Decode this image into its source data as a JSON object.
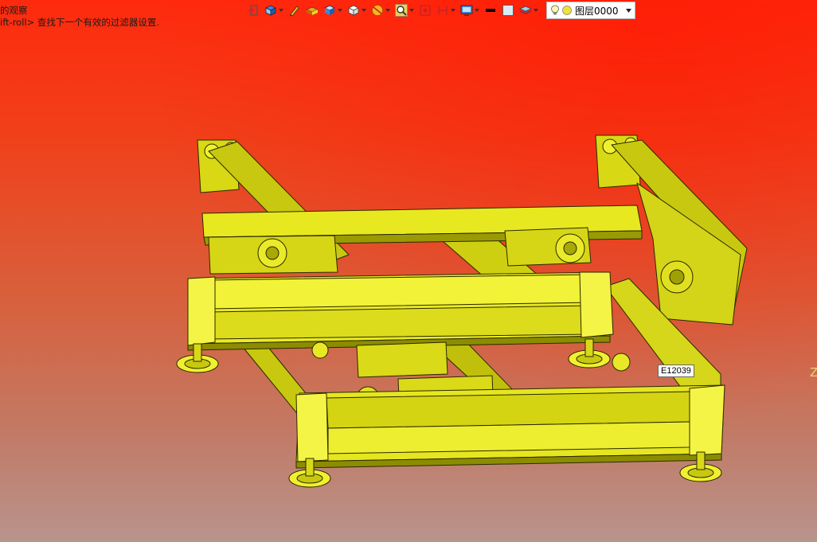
{
  "hints": {
    "line1": "的观察",
    "line2": "ift-roll> 查找下一个有效的过滤器设置."
  },
  "toolbar": {
    "icons": [
      "exit-view-icon",
      "view-orient-icon",
      "pen-icon",
      "material-icon",
      "display-mode-icon",
      "view-cube-icon",
      "section-icon",
      "zoom-icon",
      "fit-icon",
      "dimension-icon",
      "monitor-icon",
      "line-color-icon",
      "fill-color-icon",
      "layer-stack-icon"
    ],
    "layer": {
      "label": "图层0000"
    }
  },
  "viewport": {
    "tooltip": "E12039",
    "edge_label": "Z",
    "colors": {
      "model": "#e6e61a",
      "model_shadow": "#8a8a00",
      "outline": "#2a2a00"
    }
  }
}
